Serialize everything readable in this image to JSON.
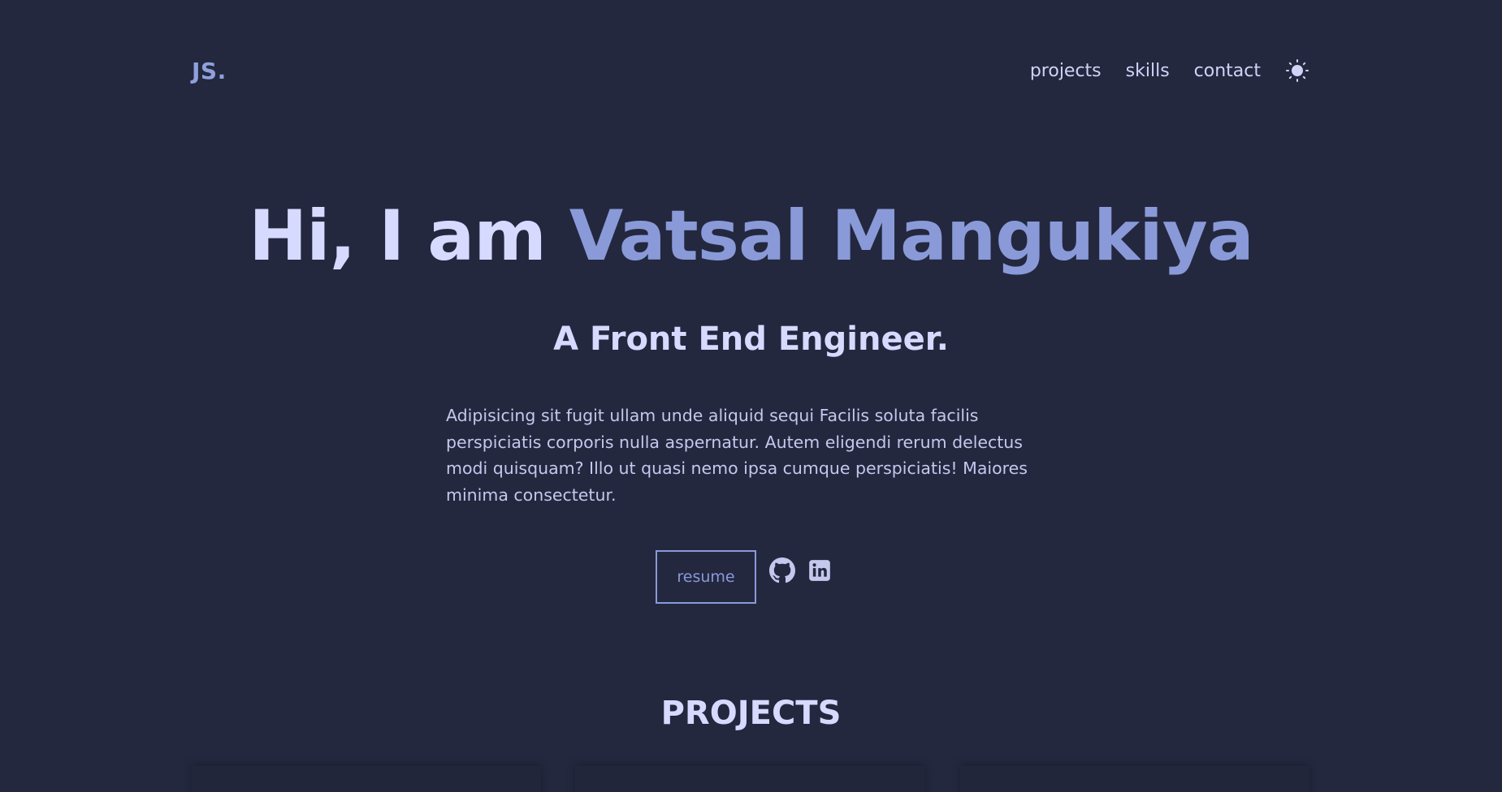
{
  "header": {
    "logo": "JS.",
    "nav": [
      "projects",
      "skills",
      "contact"
    ],
    "theme_icon": "sun-icon"
  },
  "hero": {
    "greeting": "Hi, I am ",
    "name": "Vatsal Mangukiya",
    "role": "A Front End Engineer.",
    "description": "Adipisicing sit fugit ullam unde aliquid sequi Facilis soluta facilis perspiciatis corporis nulla aspernatur. Autem eligendi rerum delectus modi quisquam? Illo ut quasi nemo ipsa cumque perspiciatis! Maiores minima consectetur.",
    "resume_label": "resume",
    "icons": [
      "github-icon",
      "linkedin-icon"
    ]
  },
  "projects": {
    "title": "PROJECTS"
  },
  "colors": {
    "background": "#23283f",
    "accent": "#8a9ad8",
    "heading": "#d7daff",
    "text": "#c4c8ec"
  }
}
